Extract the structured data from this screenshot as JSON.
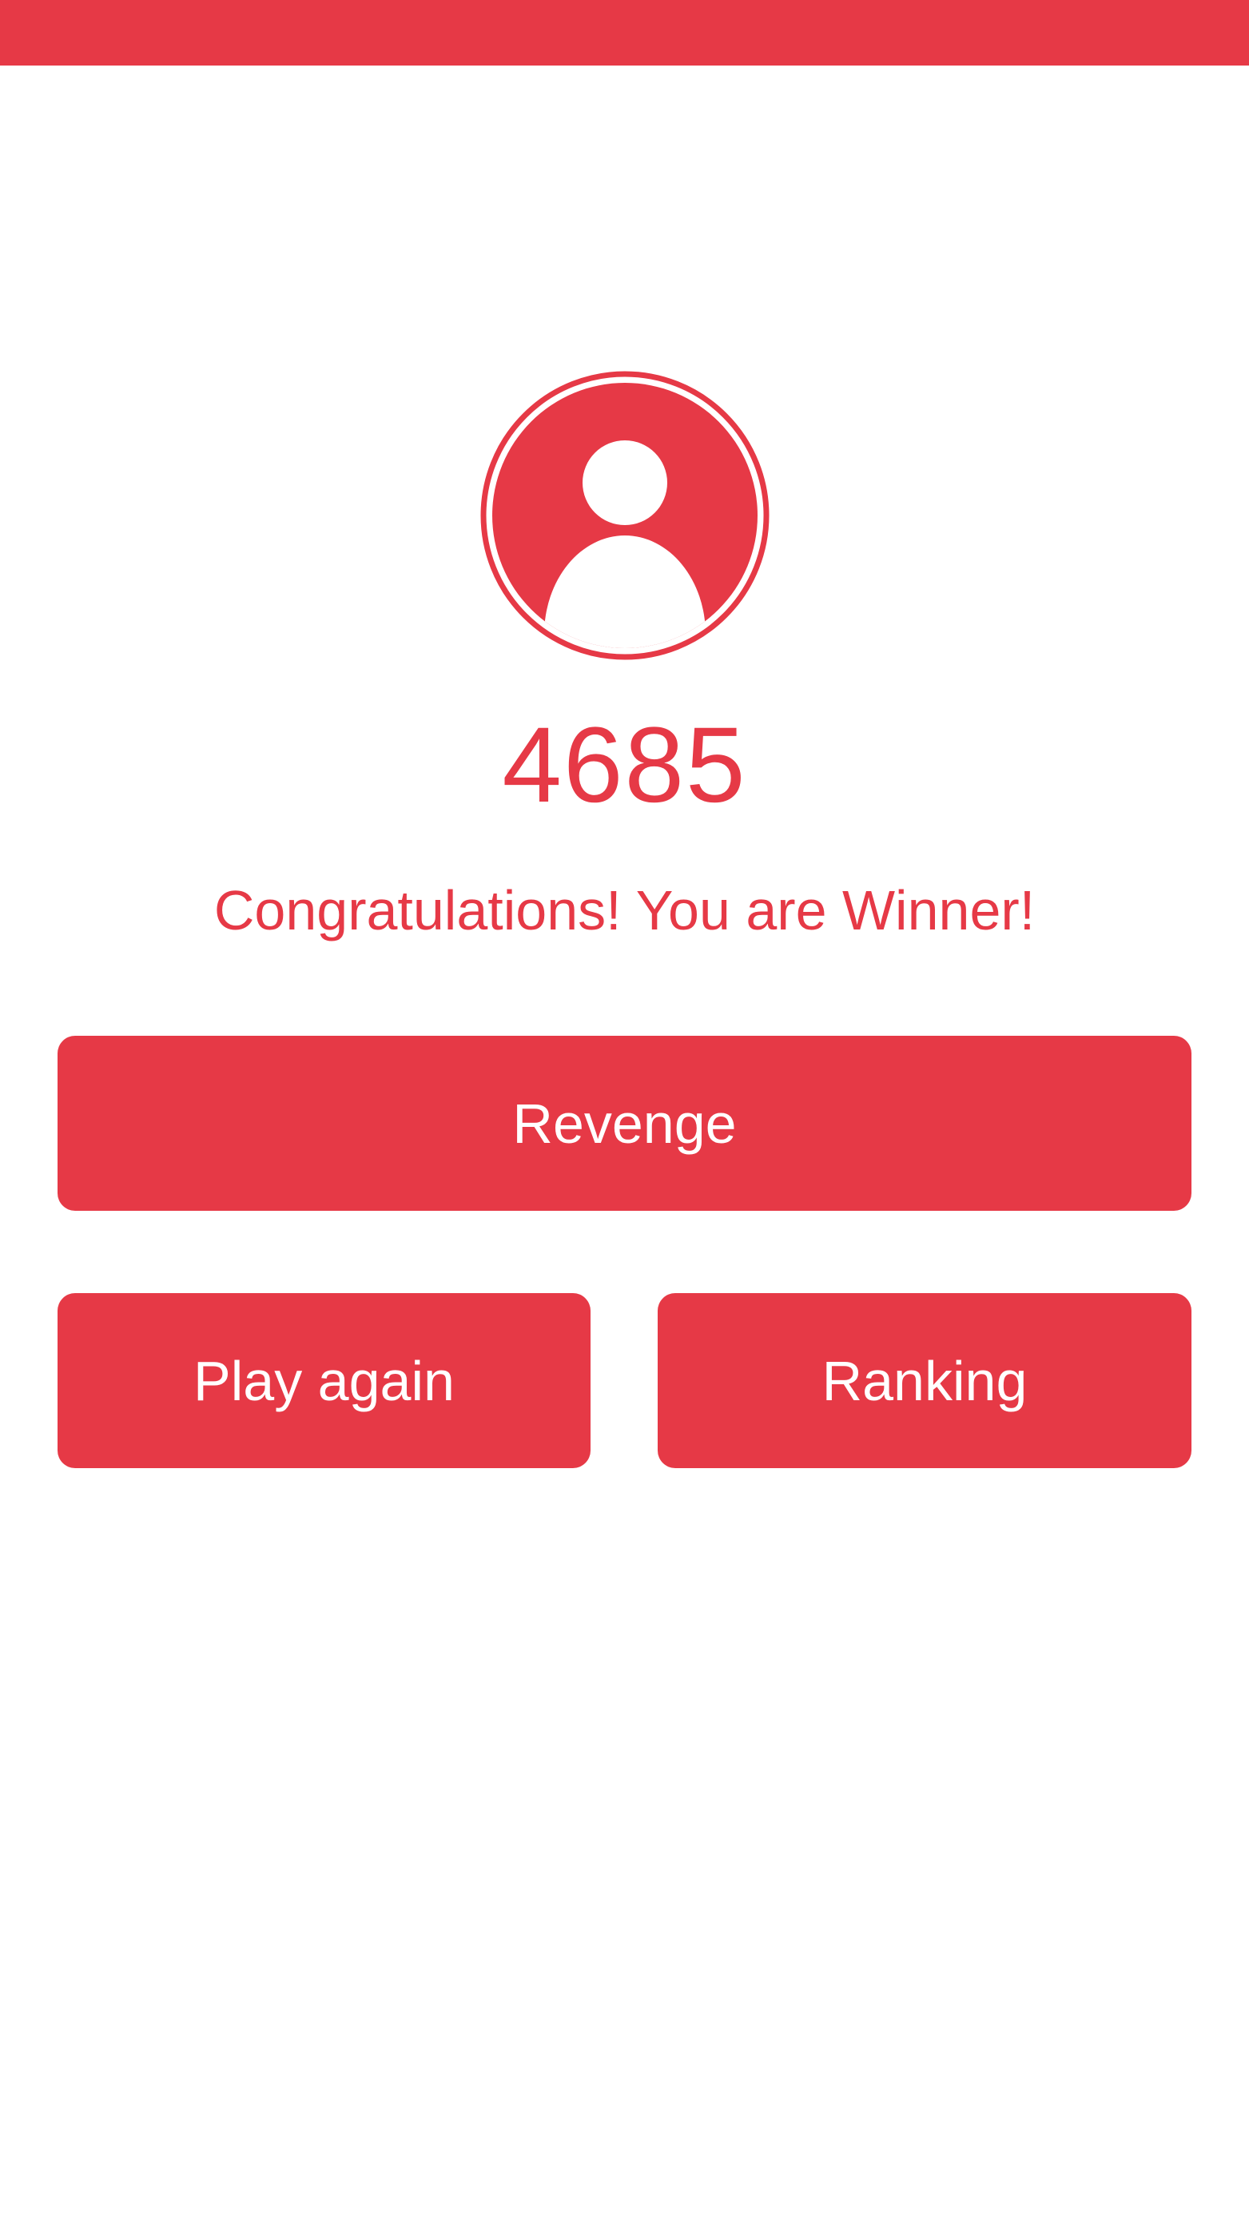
{
  "theme": {
    "accent": "#E63946",
    "background": "#FFFFFF",
    "button_text": "#FFFFFF"
  },
  "avatar": {
    "icon": "user-icon"
  },
  "result": {
    "score": "4685",
    "message": "Congratulations! You are Winner!"
  },
  "actions": {
    "revenge_label": "Revenge",
    "play_again_label": "Play again",
    "ranking_label": "Ranking"
  }
}
